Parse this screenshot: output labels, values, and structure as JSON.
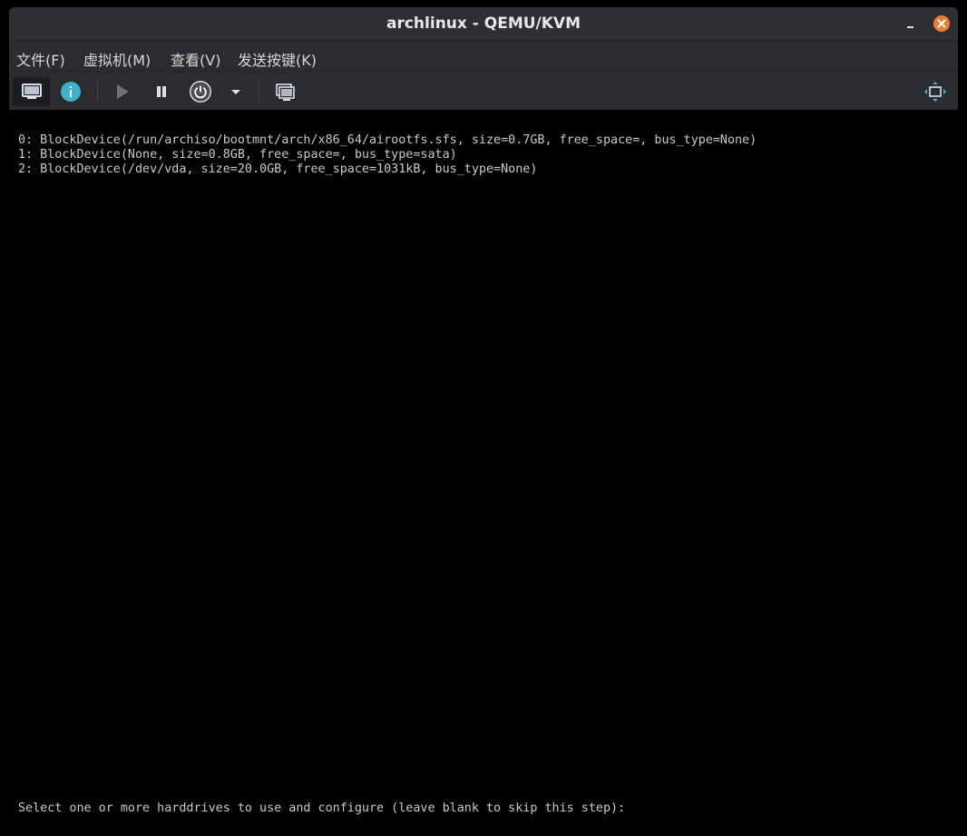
{
  "window": {
    "title": "archlinux - QEMU/KVM"
  },
  "menubar": {
    "items": [
      {
        "label": "文件(F)"
      },
      {
        "label": "虚拟机(M)"
      },
      {
        "label": "查看(V)"
      },
      {
        "label": "发送按键(K)"
      }
    ]
  },
  "toolbar": {
    "buttons": [
      {
        "icon": "monitor-icon",
        "state": "active"
      },
      {
        "icon": "info-icon"
      },
      {
        "icon": "play-icon",
        "state": "disabled"
      },
      {
        "icon": "pause-icon"
      },
      {
        "icon": "power-icon"
      },
      {
        "icon": "chevron-down-icon"
      },
      {
        "icon": "snapshots-icon"
      },
      {
        "icon": "fullscreen-icon"
      }
    ]
  },
  "console": {
    "lines": [
      "0: BlockDevice(/run/archiso/bootmnt/arch/x86_64/airootfs.sfs, size=0.7GB, free_space=, bus_type=None)",
      "1: BlockDevice(None, size=0.8GB, free_space=, bus_type=sata)",
      "2: BlockDevice(/dev/vda, size=20.0GB, free_space=1031kB, bus_type=None)"
    ],
    "prompt": "Select one or more harddrives to use and configure (leave blank to skip this step):"
  },
  "colors": {
    "titlebar_bg": "#2d2f33",
    "close_button": "#ef7d2f",
    "info_icon": "#3bb3c9",
    "console_text": "#c9c9c9",
    "console_bg": "#000000"
  }
}
